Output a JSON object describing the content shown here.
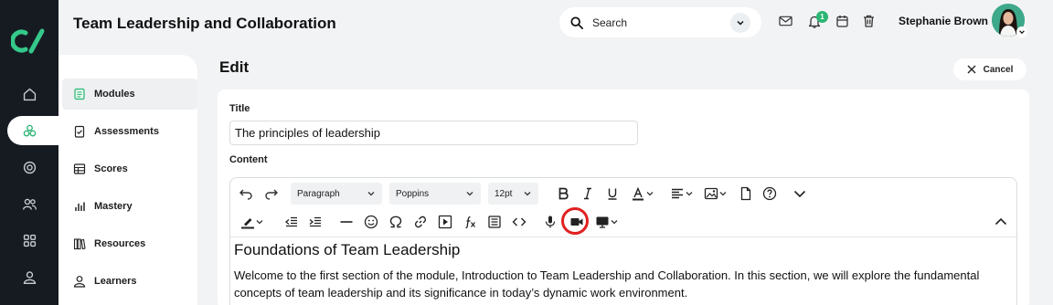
{
  "header": {
    "page_title": "Team Leadership and Collaboration",
    "search_placeholder": "Search",
    "notification_count": "1",
    "user_name": "Stephanie Brown"
  },
  "rail": {
    "items": [
      "home-icon",
      "modules-icon",
      "progress-icon",
      "people-icon",
      "apps-icon",
      "profile-icon"
    ],
    "active_index": 1
  },
  "subnav": {
    "items": [
      {
        "label": "Modules",
        "icon": "book-icon"
      },
      {
        "label": "Assessments",
        "icon": "clipboard-icon"
      },
      {
        "label": "Scores",
        "icon": "table-icon"
      },
      {
        "label": "Mastery",
        "icon": "bar-chart-icon"
      },
      {
        "label": "Resources",
        "icon": "library-icon"
      },
      {
        "label": "Learners",
        "icon": "person-icon"
      }
    ],
    "active_index": 0
  },
  "edit": {
    "heading": "Edit",
    "cancel_label": "Cancel",
    "title_label": "Title",
    "title_value": "The principles of leadership",
    "content_label": "Content"
  },
  "toolbar": {
    "block_format": "Paragraph",
    "font_family": "Poppins",
    "font_size": "12pt"
  },
  "content": {
    "heading": "Foundations of Team Leadership",
    "paragraph": "Welcome to the first section of the module, Introduction to Team Leadership and Collaboration. In this section, we will explore the fundamental concepts of team leadership and its significance in today’s dynamic work environment."
  },
  "colors": {
    "rail_bg": "#161b22",
    "accent_green": "#2bb673",
    "highlight_red": "#e02020"
  }
}
